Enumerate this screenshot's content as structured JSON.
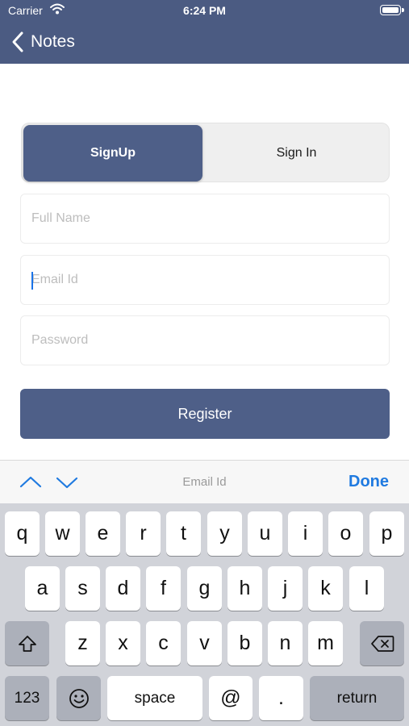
{
  "status_bar": {
    "carrier": "Carrier",
    "time": "6:24 PM"
  },
  "nav": {
    "back_label": "Notes"
  },
  "segment": {
    "signup": "SignUp",
    "signin": "Sign In"
  },
  "form": {
    "full_name_placeholder": "Full Name",
    "email_placeholder": "Email Id",
    "password_placeholder": "Password",
    "register_label": "Register"
  },
  "accessory": {
    "field_label": "Email Id",
    "done_label": "Done"
  },
  "keyboard": {
    "row1": [
      "q",
      "w",
      "e",
      "r",
      "t",
      "y",
      "u",
      "i",
      "o",
      "p"
    ],
    "row2": [
      "a",
      "s",
      "d",
      "f",
      "g",
      "h",
      "j",
      "k",
      "l"
    ],
    "row3": [
      "z",
      "x",
      "c",
      "v",
      "b",
      "n",
      "m"
    ],
    "numbers_key": "123",
    "space_key": "space",
    "at_key": "@",
    "period_key": ".",
    "return_key": "return"
  },
  "colors": {
    "nav_bg": "#4b5b82",
    "accent": "#4e5f88",
    "done": "#1f7ae0"
  }
}
